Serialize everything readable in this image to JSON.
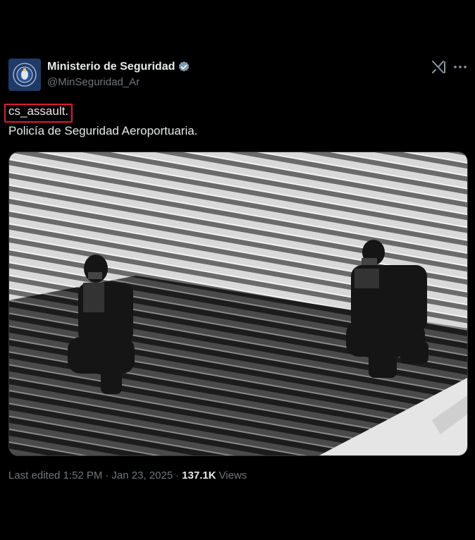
{
  "tweet": {
    "display_name": "Ministerio de Seguridad",
    "handle": "@MinSeguridad_Ar",
    "text_line1": "cs_assault.",
    "text_line2": "Policía de Seguridad Aeroportuaria.",
    "edited_label": "Last edited 1:52 PM",
    "separator": "·",
    "date": "Jan 23, 2025",
    "views_count": "137.1K",
    "views_label": "Views"
  },
  "icons": {
    "verified": "verified-badge-icon",
    "grok": "grok-icon",
    "more": "more-dots-icon"
  },
  "colors": {
    "background": "#000000",
    "highlight_border": "#e21b2b",
    "verified_badge": "#829aab",
    "secondary_text": "#71767b"
  }
}
